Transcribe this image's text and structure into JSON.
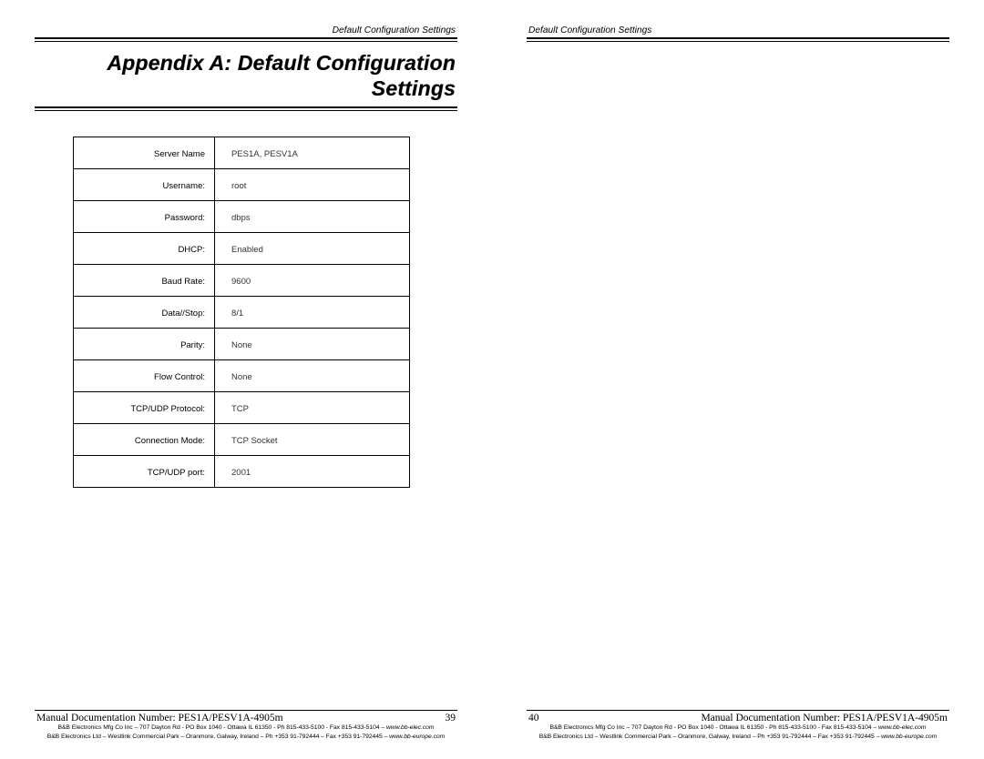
{
  "header": {
    "left_running_head": "Default Configuration Settings",
    "right_running_head": "Default Configuration Settings"
  },
  "title_line1": "Appendix A: Default Configuration",
  "title_line2": "Settings",
  "settings": [
    {
      "label": "Server Name",
      "value": "PES1A, PESV1A"
    },
    {
      "label": "Username:",
      "value": "root"
    },
    {
      "label": "Password:",
      "value": "dbps"
    },
    {
      "label": "DHCP:",
      "value": "Enabled"
    },
    {
      "label": "Baud Rate:",
      "value": "9600"
    },
    {
      "label": "Data//Stop:",
      "value": "8/1"
    },
    {
      "label": "Parity:",
      "value": "None"
    },
    {
      "label": "Flow Control:",
      "value": "None"
    },
    {
      "label": "TCP/UDP Protocol:",
      "value": "TCP"
    },
    {
      "label": "Connection Mode:",
      "value": "TCP Socket"
    },
    {
      "label": "TCP/UDP port:",
      "value": "2001"
    }
  ],
  "footer": {
    "doc_number_label": "Manual Documentation Number:  PES1A/PESV1A-4905m",
    "page_left": "39",
    "page_right": "40",
    "fine_print_1": "B&B Electronics Mfg Co Inc – 707 Dayton Rd - PO Box 1040 - Ottawa IL 61350 - Ph 815-433-5100 - Fax 815-433-5104 – ",
    "fine_print_1_site": "www.bb-elec.com",
    "fine_print_2": "B&B Electronics Ltd – Westlink Commercial Park – Oranmore, Galway, Ireland – Ph +353 91-792444 – Fax +353 91-792445 – ",
    "fine_print_2_site": "www.bb-europe.com"
  }
}
